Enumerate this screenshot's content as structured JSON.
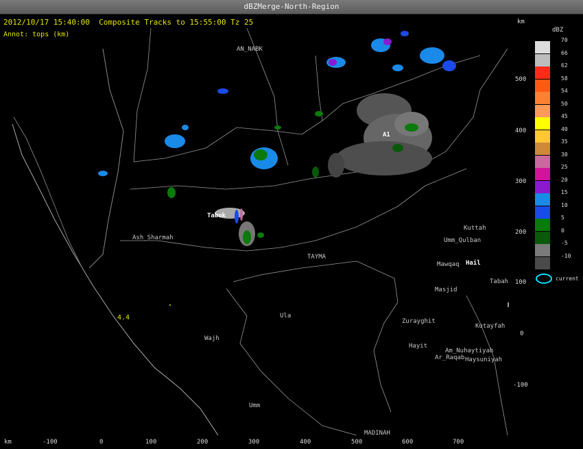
{
  "window": {
    "title": "dBZMerge-North-Region"
  },
  "header": {
    "timestamp": "2012/10/17 15:40:00",
    "tracks": "Composite Tracks to 15:55:00 Tz 25",
    "annot": "Annot: tops (km)",
    "km_label": "km"
  },
  "axes": {
    "x_label": "km",
    "x_ticks": [
      "-100",
      "0",
      "100",
      "200",
      "300",
      "400",
      "500",
      "600",
      "700"
    ],
    "y_label": "km",
    "y_ticks": [
      "500",
      "400",
      "300",
      "200",
      "100",
      "0",
      "-100"
    ]
  },
  "places": [
    {
      "name": "AN_NABK",
      "style": "plain"
    },
    {
      "name": "Ash_Sharmah",
      "style": "plain"
    },
    {
      "name": "TAYMA",
      "style": "plain"
    },
    {
      "name": "Ula",
      "style": "plain"
    },
    {
      "name": "Wajh",
      "style": "plain"
    },
    {
      "name": "Umm",
      "style": "plain"
    },
    {
      "name": "MADINAH",
      "style": "plain"
    },
    {
      "name": "Kuttah",
      "style": "plain"
    },
    {
      "name": "Umm_Qulban",
      "style": "plain"
    },
    {
      "name": "Mawqaq",
      "style": "plain"
    },
    {
      "name": "Hail",
      "style": "white"
    },
    {
      "name": "Tabah",
      "style": "plain"
    },
    {
      "name": "Masjid",
      "style": "plain"
    },
    {
      "name": "Zurayghit",
      "style": "plain"
    },
    {
      "name": "Kutayfah",
      "style": "plain"
    },
    {
      "name": "Hayit",
      "style": "plain"
    },
    {
      "name": "Am_Nuhaytiyah",
      "style": "plain"
    },
    {
      "name": "Ar_Raqab",
      "style": "plain"
    },
    {
      "name": "Haysuniyah",
      "style": "plain"
    },
    {
      "name": "Tabuk",
      "style": "white"
    },
    {
      "name": "A1",
      "style": "white"
    }
  ],
  "annotations": {
    "tops_value": "4.4"
  },
  "legend": {
    "title": "dBZ",
    "entries": [
      {
        "label": "70",
        "color": "#dcdcdc"
      },
      {
        "label": "66",
        "color": "#bdbdbd"
      },
      {
        "label": "62",
        "color": "#ff2a1a"
      },
      {
        "label": "58",
        "color": "#ff5a10"
      },
      {
        "label": "54",
        "color": "#ff8030"
      },
      {
        "label": "50",
        "color": "#ff9a5a"
      },
      {
        "label": "45",
        "color": "#ffff00"
      },
      {
        "label": "40",
        "color": "#ffc830"
      },
      {
        "label": "35",
        "color": "#cc8a3a"
      },
      {
        "label": "30",
        "color": "#c86aa0"
      },
      {
        "label": "25",
        "color": "#d4129a"
      },
      {
        "label": "20",
        "color": "#8a1ad0"
      },
      {
        "label": "15",
        "color": "#1a8ae8"
      },
      {
        "label": "10",
        "color": "#1a4ae8"
      },
      {
        "label": "5",
        "color": "#0a7a0a"
      },
      {
        "label": "0",
        "color": "#0a580a"
      },
      {
        "label": "-5",
        "color": "#7a7a7a"
      },
      {
        "label": "-10",
        "color": "#4a4a4a"
      }
    ],
    "current_label": "current",
    "current_color": "#00e5ff"
  }
}
